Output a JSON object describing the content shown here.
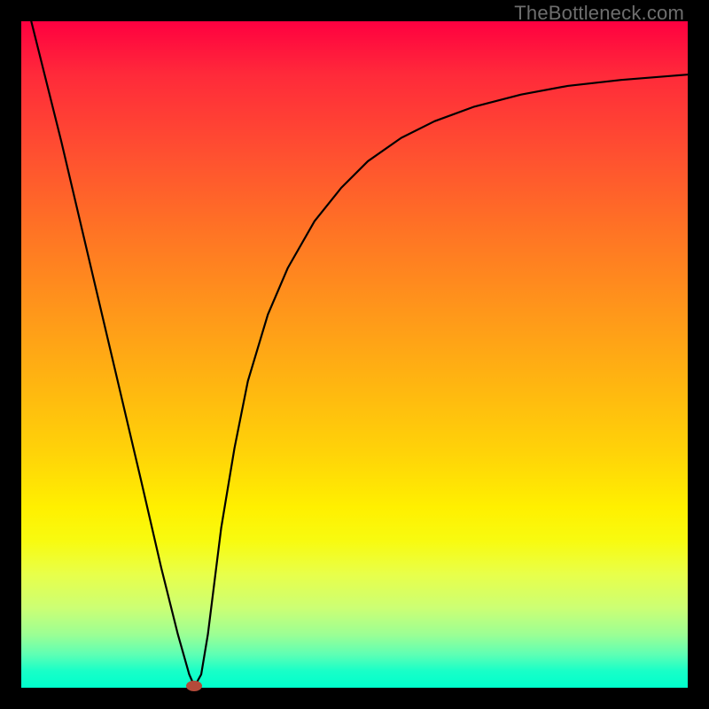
{
  "watermark": "TheBottleneck.com",
  "chart_data": {
    "type": "line",
    "title": "",
    "xlabel": "",
    "ylabel": "",
    "xlim": [
      0,
      100
    ],
    "ylim": [
      0,
      100
    ],
    "grid": false,
    "legend": false,
    "series": [
      {
        "name": "curve",
        "x": [
          1.5,
          6,
          10,
          14,
          18,
          21,
          23.5,
          25.2,
          26,
          27,
          28,
          29,
          30,
          32,
          34,
          37,
          40,
          44,
          48,
          52,
          57,
          62,
          68,
          75,
          82,
          90,
          100
        ],
        "y": [
          100,
          82,
          65,
          48,
          31,
          18,
          8,
          2,
          0.2,
          2,
          8,
          16,
          24,
          36,
          46,
          56,
          63,
          70,
          75,
          79,
          82.5,
          85,
          87.2,
          89,
          90.3,
          91.2,
          92
        ]
      }
    ],
    "marker": {
      "x": 25.9,
      "y": 0.2
    },
    "background_gradient": {
      "top_color": "#ff0040",
      "bottom_color": "#00ffcc"
    }
  }
}
